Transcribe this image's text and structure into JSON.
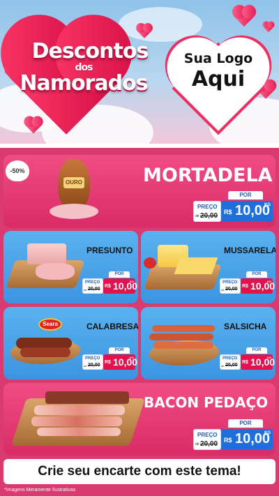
{
  "header": {
    "title_line1": "Descontos",
    "title_line2": "dos",
    "title_line3": "Namorados",
    "logo_line1": "Sua Logo",
    "logo_line2": "Aqui"
  },
  "discount_badge": "-50%",
  "products": {
    "mortadela": {
      "name": "MORTADELA",
      "por": "POR",
      "preco": "PREÇO",
      "de": "de",
      "old": "20,00",
      "currency": "R$",
      "price": "10,00",
      "unit": "KG",
      "brand": "OURO"
    },
    "presunto": {
      "name": "PRESUNTO",
      "por": "POR",
      "preco": "PREÇO",
      "de": "de",
      "old": "20,00",
      "currency": "R$",
      "price": "10,00",
      "unit": "KG"
    },
    "mussarela": {
      "name": "MUSSARELA",
      "por": "POR",
      "preco": "PREÇO",
      "de": "de",
      "old": "20,00",
      "currency": "R$",
      "price": "10,00",
      "unit": "KG"
    },
    "calabresa": {
      "name": "CALABRESA",
      "por": "POR",
      "preco": "PREÇO",
      "de": "de",
      "old": "20,00",
      "currency": "R$",
      "price": "10,00",
      "unit": "KG",
      "brand": "Seara"
    },
    "salsicha": {
      "name": "SALSICHA",
      "por": "POR",
      "preco": "PREÇO",
      "de": "de",
      "old": "20,00",
      "currency": "R$",
      "price": "10,00",
      "unit": "KG"
    },
    "bacon": {
      "name": "BACON PEDAÇO",
      "por": "POR",
      "preco": "PREÇO",
      "de": "de",
      "old": "20,00",
      "currency": "R$",
      "price": "10,00",
      "unit": "KG"
    }
  },
  "cta": "Crie seu encarte com este tema!",
  "disclaimer": "*Imagens Meramente Ilustrativas",
  "colors": {
    "pink": "#e8407a",
    "blue": "#4aa3ea",
    "price_blue": "#1e6fd9",
    "price_red": "#e0134f"
  }
}
